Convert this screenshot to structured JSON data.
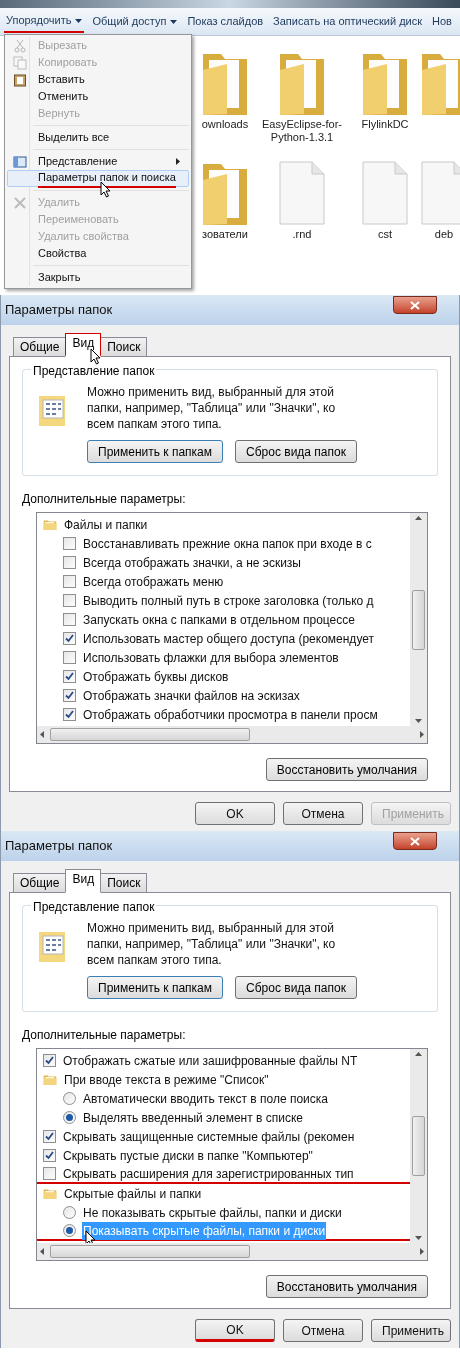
{
  "explorer": {
    "toolbar": [
      {
        "label": "Упорядочить",
        "dropdown": true,
        "underlined": true
      },
      {
        "label": "Общий доступ",
        "dropdown": true,
        "underlined": false
      },
      {
        "label": "Показ слайдов",
        "dropdown": false,
        "underlined": false
      },
      {
        "label": "Записать на оптический диск",
        "dropdown": false,
        "underlined": false
      },
      {
        "label": "Нов",
        "dropdown": false,
        "underlined": false
      }
    ],
    "menu": [
      {
        "kind": "item",
        "label": "Вырезать",
        "disabled": true,
        "highlighted": false,
        "submenu": false,
        "underlined": false
      },
      {
        "kind": "item",
        "label": "Копировать",
        "disabled": true,
        "highlighted": false,
        "submenu": false,
        "underlined": false
      },
      {
        "kind": "item",
        "label": "Вставить",
        "disabled": false,
        "highlighted": false,
        "submenu": false,
        "underlined": false
      },
      {
        "kind": "item",
        "label": "Отменить",
        "disabled": false,
        "highlighted": false,
        "submenu": false,
        "underlined": false
      },
      {
        "kind": "item",
        "label": "Вернуть",
        "disabled": true,
        "highlighted": false,
        "submenu": false,
        "underlined": false
      },
      {
        "kind": "separator"
      },
      {
        "kind": "item",
        "label": "Выделить все",
        "disabled": false,
        "highlighted": false,
        "submenu": false,
        "underlined": false
      },
      {
        "kind": "separator"
      },
      {
        "kind": "item",
        "label": "Представление",
        "disabled": false,
        "highlighted": false,
        "submenu": true,
        "underlined": false
      },
      {
        "kind": "item",
        "label": "Параметры папок и поиска",
        "disabled": false,
        "highlighted": true,
        "submenu": false,
        "underlined": true
      },
      {
        "kind": "separator"
      },
      {
        "kind": "item",
        "label": "Удалить",
        "disabled": true,
        "highlighted": false,
        "submenu": false,
        "underlined": false
      },
      {
        "kind": "item",
        "label": "Переименовать",
        "disabled": true,
        "highlighted": false,
        "submenu": false,
        "underlined": false
      },
      {
        "kind": "item",
        "label": "Удалить свойства",
        "disabled": true,
        "highlighted": false,
        "submenu": false,
        "underlined": false
      },
      {
        "kind": "item",
        "label": "Свойства",
        "disabled": false,
        "highlighted": false,
        "submenu": false,
        "underlined": false
      },
      {
        "kind": "separator"
      },
      {
        "kind": "item",
        "label": "Закрыть",
        "disabled": false,
        "highlighted": false,
        "submenu": false,
        "underlined": false
      }
    ],
    "files": [
      {
        "kind": "folder",
        "label": "ownloads"
      },
      {
        "kind": "folder",
        "label": "EasyEclipse-for-Python-1.3.1"
      },
      {
        "kind": "folder",
        "label": "FlylinkDC"
      },
      {
        "kind": "folder"
      },
      {
        "kind": "folder",
        "label": "зователи"
      },
      {
        "kind": "file",
        "label": ".rnd"
      },
      {
        "kind": "file",
        "label": "cst"
      },
      {
        "kind": "file",
        "label": "deb"
      }
    ]
  },
  "dialogs": [
    {
      "title": "Параметры папок",
      "tabs": [
        {
          "label": "Общие",
          "selected": false,
          "underlined": false
        },
        {
          "label": "Вид",
          "selected": true,
          "underlined": true
        },
        {
          "label": "Поиск",
          "selected": false,
          "underlined": false
        }
      ],
      "group": {
        "legend": "Представление папок",
        "text": "Можно применить вид, выбранный для этой папки, например, \"Таблица\" или \"Значки\", ко всем папкам этого типа.",
        "buttons": [
          "Применить к папкам",
          "Сброс вида папок"
        ]
      },
      "advanced_label": "Дополнительные параметры:",
      "tree": [
        {
          "kind": "folder",
          "label": "Файлы и папки",
          "children": [
            {
              "kind": "checkbox",
              "label": "Восстанавливать прежние окна папок при входе в с",
              "checked": false,
              "highlighted": false,
              "underlined": false
            },
            {
              "kind": "checkbox",
              "label": "Всегда отображать значки, а не эскизы",
              "checked": false,
              "highlighted": false,
              "underlined": false
            },
            {
              "kind": "checkbox",
              "label": "Всегда отображать меню",
              "checked": false,
              "highlighted": false,
              "underlined": false
            },
            {
              "kind": "checkbox",
              "label": "Выводить полный путь в строке заголовка (только д",
              "checked": false,
              "highlighted": false,
              "underlined": false
            },
            {
              "kind": "checkbox",
              "label": "Запускать окна с папками в отдельном процессе",
              "checked": false,
              "highlighted": false,
              "underlined": false
            },
            {
              "kind": "checkbox",
              "label": "Использовать мастер общего доступа (рекомендует",
              "checked": true,
              "highlighted": false,
              "underlined": false
            },
            {
              "kind": "checkbox",
              "label": "Использовать флажки для выбора элементов",
              "checked": false,
              "highlighted": false,
              "underlined": false
            },
            {
              "kind": "checkbox",
              "label": "Отображать буквы дисков",
              "checked": true,
              "highlighted": false,
              "underlined": false
            },
            {
              "kind": "checkbox",
              "label": "Отображать значки файлов на эскизах",
              "checked": true,
              "highlighted": false,
              "underlined": false
            },
            {
              "kind": "checkbox",
              "label": "Отображать обработчики просмотра в панели просм",
              "checked": true,
              "highlighted": false,
              "underlined": false
            }
          ]
        }
      ],
      "restore_button": "Восстановить умолчания",
      "buttons": [
        {
          "label": "OK",
          "disabled": false,
          "underlined": false
        },
        {
          "label": "Отмена",
          "disabled": false,
          "underlined": false
        },
        {
          "label": "Применить",
          "disabled": true,
          "underlined": false
        }
      ]
    },
    {
      "title": "Параметры папок",
      "tabs": [
        {
          "label": "Общие",
          "selected": false,
          "underlined": false
        },
        {
          "label": "Вид",
          "selected": true,
          "underlined": false
        },
        {
          "label": "Поиск",
          "selected": false,
          "underlined": false
        }
      ],
      "group": {
        "legend": "Представление папок",
        "text": "Можно применить вид, выбранный для этой папки, например, \"Таблица\" или \"Значки\", ко всем папкам этого типа.",
        "buttons": [
          "Применить к папкам",
          "Сброс вида папок"
        ]
      },
      "advanced_label": "Дополнительные параметры:",
      "tree": [
        {
          "kind": "checkbox",
          "label": "Отображать сжатые или зашифрованные файлы NT",
          "checked": true,
          "highlighted": false,
          "underlined": false
        },
        {
          "kind": "folder",
          "label": "При вводе текста в режиме \"Список\"",
          "children": [
            {
              "kind": "radio",
              "label": "Автоматически вводить текст в поле поиска",
              "checked": false,
              "highlighted": false,
              "underlined": false
            },
            {
              "kind": "radio",
              "label": "Выделять введенный элемент в списке",
              "checked": true,
              "highlighted": false,
              "underlined": false
            }
          ]
        },
        {
          "kind": "checkbox",
          "label": "Скрывать защищенные системные файлы (рекомен",
          "checked": true,
          "highlighted": false,
          "underlined": false
        },
        {
          "kind": "checkbox",
          "label": "Скрывать пустые диски в папке \"Компьютер\"",
          "checked": true,
          "highlighted": false,
          "underlined": false
        },
        {
          "kind": "checkbox",
          "label": "Скрывать расширения для зарегистрированных тип",
          "checked": false,
          "highlighted": false,
          "underlined": true
        },
        {
          "kind": "folder",
          "label": "Скрытые файлы и папки",
          "children": [
            {
              "kind": "radio",
              "label": "Не показывать скрытые файлы, папки и диски",
              "checked": false,
              "highlighted": false,
              "underlined": false
            },
            {
              "kind": "radio",
              "label": "Показывать скрытые файлы, папки и диски",
              "checked": true,
              "highlighted": true,
              "underlined": true
            }
          ]
        }
      ],
      "restore_button": "Восстановить умолчания",
      "buttons": [
        {
          "label": "OK",
          "disabled": false,
          "underlined": true
        },
        {
          "label": "Отмена",
          "disabled": false,
          "underlined": false
        },
        {
          "label": "Применить",
          "disabled": false,
          "underlined": false
        }
      ]
    }
  ]
}
